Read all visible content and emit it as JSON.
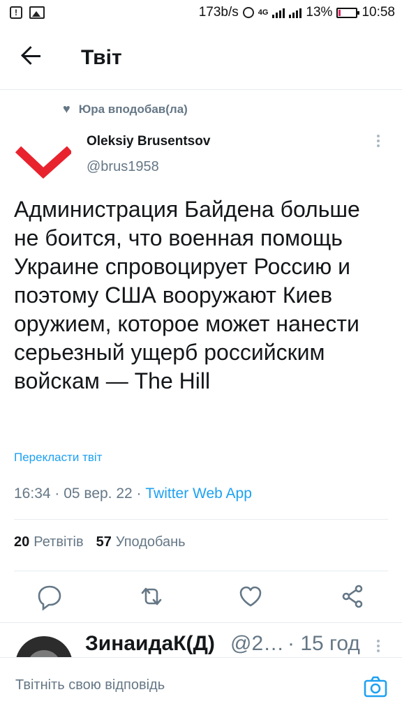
{
  "status_bar": {
    "speed": "173b/s",
    "network": "4G",
    "battery": "13%",
    "battery_level": 0.13,
    "time": "10:58"
  },
  "header": {
    "title": "Твіт"
  },
  "tweet": {
    "liked_by": "Юра вподобав(ла)",
    "author_name": "Oleksiy Brusentsov",
    "author_handle": "@brus1958",
    "text": "Администрация Байдена больше не боится, что военная помощь Украине спровоцирует Россию и поэтому США вооружают Киев оружием, которое может нанести серьезный ущерб российским войскам — The Hill",
    "translate_label": "Перекласти твіт",
    "timestamp": "16:34 · 05 вер. 22 · ",
    "source": "Twitter Web App",
    "retweets_count": "20",
    "retweets_label": "Ретвітів",
    "likes_count": "57",
    "likes_label": "Уподобань"
  },
  "actions": [
    "reply-icon",
    "retweet-icon",
    "like-icon",
    "share-icon"
  ],
  "reply_preview": {
    "name": "ЗинаидаК(Д)",
    "handle": "@2…",
    "time": "· 15 год"
  },
  "compose": {
    "placeholder": "Твітніть свою відповідь"
  },
  "colors": {
    "accent": "#1da1f2",
    "text": "#14171a",
    "muted": "#657786",
    "divider": "#e6ecf0",
    "logo_red": "#e8232e"
  }
}
